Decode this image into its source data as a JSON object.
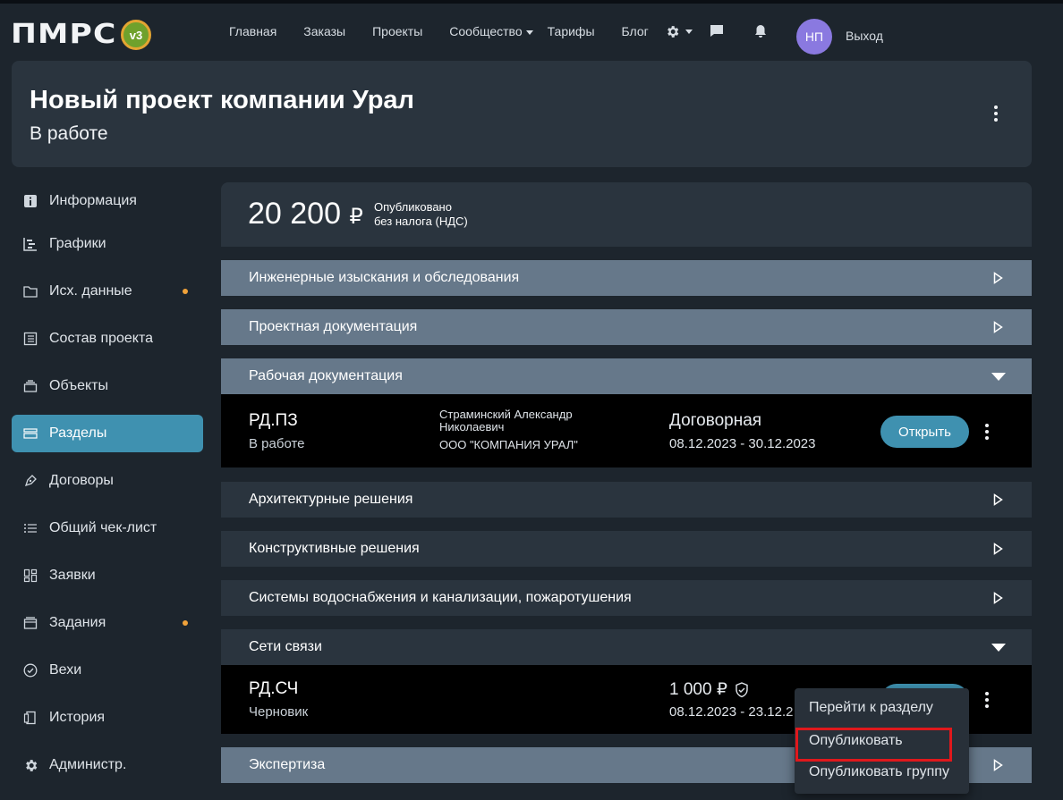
{
  "header": {
    "logo_text": "ПМРС",
    "logo_badge": "v3",
    "nav": [
      "Главная",
      "Заказы",
      "Проекты",
      "Сообщество",
      "Тарифы",
      "Блог"
    ],
    "avatar_initials": "НП",
    "logout_label": "Выход"
  },
  "project": {
    "title": "Новый проект компании Урал",
    "status": "В работе"
  },
  "sidebar": {
    "items": [
      {
        "label": "Информация"
      },
      {
        "label": "Графики"
      },
      {
        "label": "Исх. данные"
      },
      {
        "label": "Состав проекта"
      },
      {
        "label": "Объекты"
      },
      {
        "label": "Разделы"
      },
      {
        "label": "Договоры"
      },
      {
        "label": "Общий чек-лист"
      },
      {
        "label": "Заявки"
      },
      {
        "label": "Задания"
      },
      {
        "label": "Вехи"
      },
      {
        "label": "История"
      },
      {
        "label": "Администр."
      }
    ]
  },
  "price": {
    "value": "20 200",
    "currency": "₽",
    "line1": "Опубликовано",
    "line2": "без налога (НДС)"
  },
  "sections": [
    {
      "title": "Инженерные изыскания и обследования"
    },
    {
      "title": "Проектная документация"
    },
    {
      "title": "Рабочая документация"
    },
    {
      "title": "Архитектурные решения"
    },
    {
      "title": "Конструктивные решения"
    },
    {
      "title": "Системы водоснабжения и канализации, пожаротушения"
    },
    {
      "title": "Сети связи"
    },
    {
      "title": "Экспертиза"
    }
  ],
  "rows": [
    {
      "code": "РД.ПЗ",
      "status": "В работе",
      "person_line1": "Страминский Александр",
      "person_line2": "Николаевич",
      "company": "ООО \"КОМПАНИЯ УРАЛ\"",
      "price": "Договорная",
      "dates": "08.12.2023 - 30.12.2023",
      "button": "Открыть"
    },
    {
      "code": "РД.СЧ",
      "status": "Черновик",
      "price": "1 000 ₽",
      "dates": "08.12.2023 - 23.12.2"
    }
  ],
  "context_menu": {
    "items": [
      "Перейти к разделу",
      "Опубликовать",
      "Опубликовать группу"
    ]
  },
  "colors": {
    "background": "#1d252d",
    "card": "#2a343e",
    "accent": "#3f91b0",
    "section_light": "#66788a",
    "avatar": "#8a79e0",
    "notify_dot": "#f0a23a",
    "highlight": "#e0181c"
  }
}
